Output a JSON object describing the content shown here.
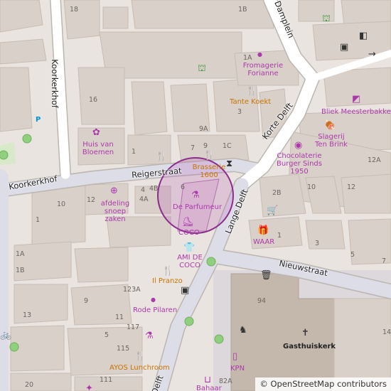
{
  "map": {
    "streets": [
      {
        "id": "reigerstraat",
        "name": "Reigerstraat"
      },
      {
        "id": "koorkerkhof_v",
        "name": "Koorkerkhof"
      },
      {
        "id": "koorkerkhof_h",
        "name": "Koorkerkhof"
      },
      {
        "id": "damplein",
        "name": "Damplein"
      },
      {
        "id": "korte_delft",
        "name": "Korte Delft"
      },
      {
        "id": "lange_delft",
        "name": "Lange Delft"
      },
      {
        "id": "nieuwstraat",
        "name": "Nieuwstraat"
      },
      {
        "id": "bottom_delft",
        "name": "Delft"
      }
    ],
    "house_numbers": [
      "18",
      "1B",
      "1A",
      "16",
      "3",
      "1C",
      "9",
      "9A",
      "7",
      "1",
      "4B",
      "4",
      "4A",
      "6",
      "10",
      "12",
      "1",
      "1A",
      "1B",
      "123A",
      "9",
      "117",
      "115",
      "111",
      "5",
      "11",
      "13",
      "20",
      "82A",
      "2B",
      "10",
      "12",
      "12A",
      "1",
      "3",
      "5",
      "7",
      "94",
      "14"
    ],
    "pois": [
      {
        "name": "Fromagerie Forianne",
        "type": "shop"
      },
      {
        "name": "Tante Koekt",
        "type": "food"
      },
      {
        "name": "Huis van Bloemen",
        "type": "shop"
      },
      {
        "name": "Brasserie 1600",
        "type": "food"
      },
      {
        "name": "De Parfumeur",
        "type": "shop"
      },
      {
        "name": "COCO",
        "type": "shop"
      },
      {
        "name": "AMI DE COCO",
        "type": "shop"
      },
      {
        "name": "Il Pranzo",
        "type": "food"
      },
      {
        "name": "Rode Pilaren",
        "type": "shop"
      },
      {
        "name": "AYOS Lunchroom",
        "type": "food"
      },
      {
        "name": "KPN",
        "type": "shop"
      },
      {
        "name": "Bahaar",
        "type": "shop"
      },
      {
        "name": "Gasthuiskerk",
        "type": "church"
      },
      {
        "name": "Bliek Meesterbakkers",
        "type": "shop"
      },
      {
        "name": "Slagerij Ten Brink",
        "type": "shop"
      },
      {
        "name": "Chocolaterie Burger Sinds 1950",
        "type": "shop"
      },
      {
        "name": "WAAR",
        "type": "shop"
      },
      {
        "name": "afdeling snoep zaken",
        "type": "shop"
      }
    ],
    "parking_label": "P",
    "colors": {
      "background": "#e9e4e0",
      "building": "#d9d0c9",
      "road": "#ffffff",
      "pedestrian": "#dddde8",
      "poi": "#ac39ac",
      "food": "#c77400",
      "highlight": "#8a2d8a"
    }
  },
  "attribution": {
    "symbol": "©",
    "text": "OpenStreetMap contributors"
  }
}
